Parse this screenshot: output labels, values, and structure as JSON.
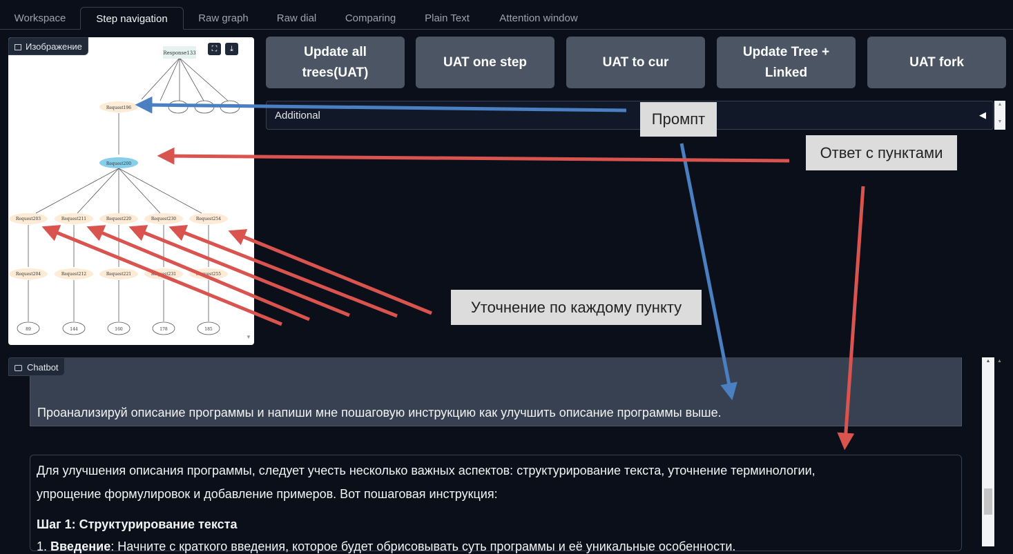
{
  "tabs": [
    "Workspace",
    "Step navigation",
    "Raw graph",
    "Raw dial",
    "Comparing",
    "Plain Text",
    "Attention window"
  ],
  "active_tab": "Step navigation",
  "image_panel": {
    "label": "Изображение",
    "nodes": {
      "root": "Response133",
      "req196": "Request196",
      "req200": "Request200",
      "mid": [
        "Request203",
        "Request211",
        "Request220",
        "Request230",
        "Request254"
      ],
      "low": [
        "Request204",
        "Request212",
        "Request221",
        "Request231",
        "Request255"
      ],
      "leaves": [
        "89",
        "144",
        "160",
        "178",
        "185"
      ]
    }
  },
  "buttons": {
    "update_all": "Update all trees(UAT)",
    "update_all_l1": "Update all",
    "update_all_l2": "trees(UAT)",
    "uat_one": "UAT one step",
    "uat_cur": "UAT to cur",
    "update_tree_l1": "Update Tree +",
    "update_tree_l2": "Linked",
    "uat_fork": "UAT fork"
  },
  "additional": {
    "label": "Additional"
  },
  "annotations": {
    "prompt": "Промпт",
    "answer": "Ответ с пунктами",
    "refine": "Уточнение по каждому пункту"
  },
  "chatbot": {
    "label": "Chatbot",
    "user_message": "Проанализируй описание программы и напиши мне пошаговую инструкцию как улучшить описание программы выше.",
    "bot_line1": "Для улучшения описания программы, следует учесть несколько важных аспектов: структурирование текста, уточнение терминологии,",
    "bot_line2": "упрощение формулировок и добавление примеров. Вот пошаговая инструкция:",
    "bot_heading": "Шаг 1: Структурирование текста",
    "bot_line3_bold": "Введение",
    "bot_line3": ": Начните с краткого введения, которое будет обрисовывать суть программы и её уникальные особенности."
  },
  "colors": {
    "red_arrow": "#d9534f",
    "blue_arrow": "#4a7fc1"
  }
}
